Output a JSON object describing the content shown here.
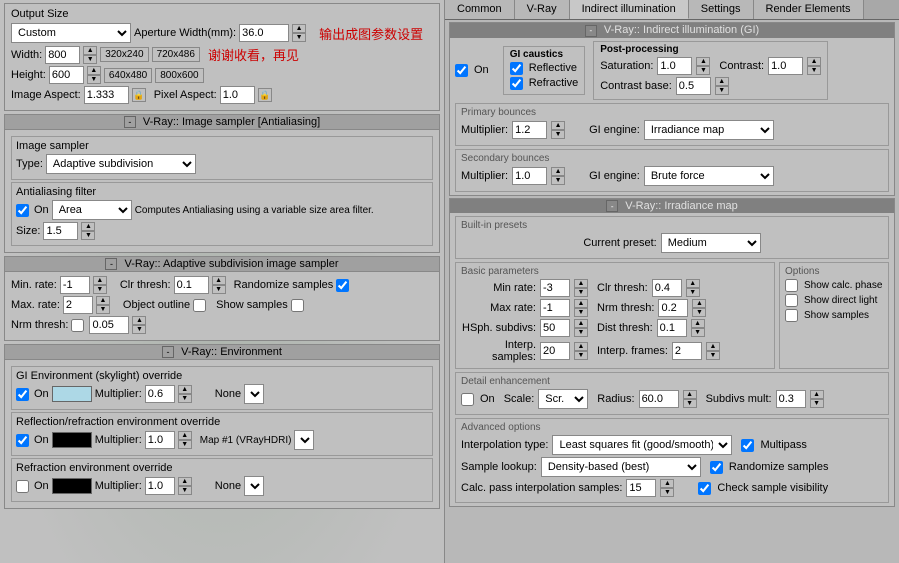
{
  "left": {
    "output_size_title": "Output Size",
    "custom_label": "Custom",
    "aperture_label": "Aperture Width(mm):",
    "aperture_value": "36.0",
    "width_label": "Width:",
    "width_value": "800",
    "height_label": "Height:",
    "height_value": "600",
    "image_aspect_label": "Image Aspect:",
    "image_aspect_value": "1.333",
    "pixel_aspect_label": "Pixel Aspect:",
    "pixel_aspect_value": "1.0",
    "preset_320x240": "320x240",
    "preset_720x486": "720x486",
    "preset_640x480": "640x480",
    "preset_800x600": "800x600",
    "chinese_title": "输出成图参数设置",
    "chinese_subtitle": "谢谢收看，再见",
    "image_sampler_section": "V-Ray:: Image sampler [Antialiasing]",
    "image_sampler_inner": "Image sampler",
    "type_label": "Type:",
    "type_value": "Adaptive subdivision",
    "antialiasing_filter": "Antialiasing filter",
    "on_label": "On",
    "filter_type": "Area",
    "filter_desc": "Computes Antialiasing using a variable size area filter.",
    "size_label": "Size:",
    "size_value": "1.5",
    "adaptive_section": "V-Ray:: Adaptive subdivision image sampler",
    "min_rate_label": "Min. rate:",
    "min_rate_value": "-1",
    "max_rate_label": "Max. rate:",
    "max_rate_value": "2",
    "clr_thresh_label": "Clr thresh:",
    "clr_thresh_value": "0.1",
    "randomize_label": "Randomize samples",
    "object_outline_label": "Object outline",
    "show_samples_label": "Show samples",
    "nrm_thresh_label": "Nrm thresh:",
    "nrm_thresh_value": "0.05",
    "environment_section": "V-Ray:: Environment",
    "gi_skylight_label": "GI Environment (skylight) override",
    "gi_on_label": "On",
    "gi_multiplier_label": "Multiplier:",
    "gi_multiplier_value": "0.6",
    "gi_none_label": "None",
    "reflection_label": "Reflection/refraction environment override",
    "ref_on_label": "On",
    "ref_multiplier_label": "Multiplier:",
    "ref_multiplier_value": "1.0",
    "ref_map_label": "Map #1  (VRayHDRI)",
    "refraction_label": "Refraction environment override",
    "refrac_on_label": "On",
    "refrac_multiplier_label": "Multiplier:",
    "refrac_multiplier_value": "1.0",
    "refrac_none_label": "None"
  },
  "right": {
    "tabs": [
      "Common",
      "V-Ray",
      "Indirect illumination",
      "Settings",
      "Render Elements"
    ],
    "active_tab": "Indirect illumination",
    "gi_section_title": "V-Ray:: Indirect illumination (GI)",
    "on_label": "On",
    "gi_caustics_title": "GI caustics",
    "reflective_label": "Reflective",
    "refractive_label": "Refractive",
    "post_processing_title": "Post-processing",
    "saturation_label": "Saturation:",
    "saturation_value": "1.0",
    "contrast_label": "Contrast:",
    "contrast_value": "1.0",
    "contrast_base_label": "Contrast base:",
    "contrast_base_value": "0.5",
    "primary_bounces_title": "Primary bounces",
    "primary_multiplier_label": "Multiplier:",
    "primary_multiplier_value": "1.2",
    "gi_engine_label": "GI engine:",
    "gi_engine_primary": "Irradiance map",
    "secondary_bounces_title": "Secondary bounces",
    "secondary_multiplier_label": "Multiplier:",
    "secondary_multiplier_value": "1.0",
    "gi_engine_secondary": "Brute force",
    "irradiance_section_title": "V-Ray:: Irradiance map",
    "built_in_presets_title": "Built-in presets",
    "current_preset_label": "Current preset:",
    "current_preset_value": "Medium",
    "basic_params_title": "Basic parameters",
    "min_rate_label": "Min rate:",
    "min_rate_value": "-3",
    "clr_thresh_label": "Clr thresh:",
    "clr_thresh_value": "0.4",
    "max_rate_label": "Max rate:",
    "max_rate_value": "-1",
    "nrm_thresh_label": "Nrm thresh:",
    "nrm_thresh_value": "0.2",
    "hsph_subdivs_label": "HSph. subdivs:",
    "hsph_subdivs_value": "50",
    "dist_thresh_label": "Dist thresh:",
    "dist_thresh_value": "0.1",
    "interp_samples_label": "Interp. samples:",
    "interp_samples_value": "20",
    "interp_frames_label": "Interp. frames:",
    "interp_frames_value": "2",
    "options_title": "Options",
    "show_calc_phase_label": "Show calc. phase",
    "show_direct_light_label": "Show direct light",
    "show_samples_label": "Show samples",
    "detail_enhancement_title": "Detail enhancement",
    "on_label2": "On",
    "scale_label": "Scale:",
    "scale_value": "Scr.",
    "radius_label": "Radius:",
    "radius_value": "60.0",
    "subdivs_mult_label": "Subdivs mult:",
    "subdivs_mult_value": "0.3",
    "advanced_options_title": "Advanced options",
    "interpolation_type_label": "Interpolation type:",
    "interpolation_type_value": "Least squares fit (good/smooth)",
    "multipass_label": "Multipass",
    "sample_lookup_label": "Sample lookup:",
    "sample_lookup_value": "Density-based (best)",
    "randomize_samples_label": "Randomize samples",
    "check_sample_visibility_label": "Check sample visibility",
    "calc_pass_label": "Calc. pass interpolation samples:",
    "calc_pass_value": "15"
  }
}
